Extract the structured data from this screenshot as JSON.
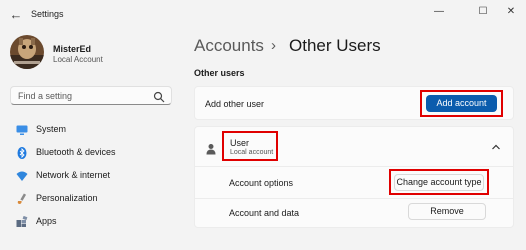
{
  "window": {
    "title": "Settings",
    "back_glyph": "←",
    "minimize_glyph": "—",
    "maximize_glyph": "☐",
    "close_glyph": "✕"
  },
  "profile": {
    "name": "MisterEd",
    "subtitle": "Local Account"
  },
  "search": {
    "placeholder": "Find a setting",
    "icon": "search-icon"
  },
  "sidebar": {
    "items": [
      {
        "label": "System",
        "icon": "monitor-icon",
        "color": "#3a8ee6"
      },
      {
        "label": "Bluetooth & devices",
        "icon": "bluetooth-icon",
        "color": "#1f7adf"
      },
      {
        "label": "Network & internet",
        "icon": "wifi-icon",
        "color": "#2f86dd"
      },
      {
        "label": "Personalization",
        "icon": "brush-icon",
        "color": "#d98a3a"
      },
      {
        "label": "Apps",
        "icon": "apps-icon",
        "color": "#5b6b82"
      }
    ]
  },
  "header": {
    "crumb_parent": "Accounts",
    "separator": "›",
    "crumb_current": "Other Users"
  },
  "section": {
    "title": "Other users"
  },
  "add_card": {
    "label": "Add other user",
    "button": "Add account"
  },
  "user_card": {
    "name": "User",
    "type": "Local account",
    "account_options_label": "Account options",
    "change_type_button": "Change account type",
    "account_data_label": "Account and data",
    "remove_button": "Remove"
  },
  "colors": {
    "accent": "#0b5cad",
    "highlight": "#e00000",
    "background": "#f3f3f3"
  }
}
